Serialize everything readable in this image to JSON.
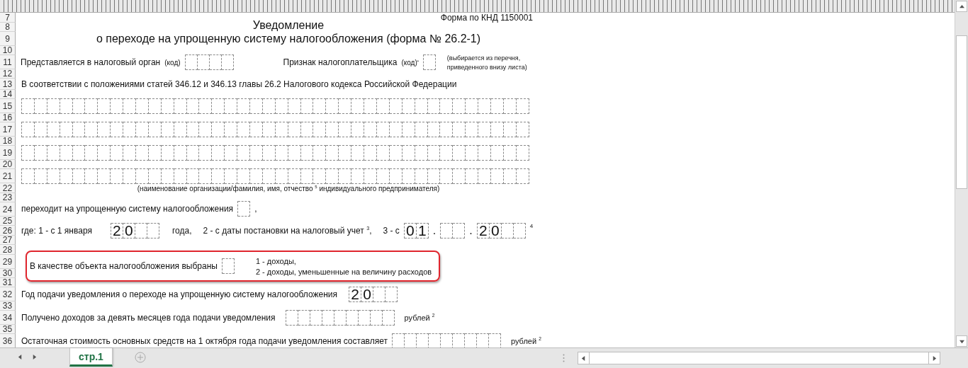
{
  "row_numbers": [
    "7",
    "8",
    "9",
    "10",
    "11",
    "12",
    "13",
    "14",
    "15",
    "16",
    "17",
    "18",
    "19",
    "20",
    "21",
    "22",
    "23",
    "24",
    "25",
    "26",
    "27",
    "28",
    "29",
    "30",
    "31",
    "32",
    "33",
    "34",
    "35",
    "36"
  ],
  "form_code": "Форма по КНД 1150001",
  "title": "Уведомление",
  "subtitle": "о переходе на упрощенную систему налогообложения (форма № 26.2-1)",
  "tax_authority": {
    "label": "Представляется в налоговый орган",
    "code_label": "(код)",
    "cells": [
      {},
      {},
      {},
      {}
    ]
  },
  "taxpayer_sign": {
    "label": "Признак налогоплательщика",
    "code_label": "(код)$^{•}$",
    "cells": [
      {}
    ],
    "note_lines": [
      "(выбирается из перечня,",
      "приведенного внизу листа)"
    ]
  },
  "legal_basis": "В соответствии с положениями статей 346.12 и 346.13 главы 26.2 Налогового кодекса Российской Федерации",
  "name_rows": [
    {
      "cells": [
        {},
        {},
        {},
        {},
        {},
        {},
        {},
        {},
        {},
        {},
        {},
        {},
        {},
        {},
        {},
        {},
        {},
        {},
        {},
        {},
        {},
        {},
        {},
        {},
        {},
        {},
        {},
        {},
        {},
        {},
        {},
        {},
        {},
        {},
        {},
        {},
        {},
        {},
        {},
        {}
      ]
    },
    {
      "cells": [
        {},
        {},
        {},
        {},
        {},
        {},
        {},
        {},
        {},
        {},
        {},
        {},
        {},
        {},
        {},
        {},
        {},
        {},
        {},
        {},
        {},
        {},
        {},
        {},
        {},
        {},
        {},
        {},
        {},
        {},
        {},
        {},
        {},
        {},
        {},
        {},
        {},
        {},
        {},
        {}
      ]
    },
    {
      "cells": [
        {},
        {},
        {},
        {},
        {},
        {},
        {},
        {},
        {},
        {},
        {},
        {},
        {},
        {},
        {},
        {},
        {},
        {},
        {},
        {},
        {},
        {},
        {},
        {},
        {},
        {},
        {},
        {},
        {},
        {},
        {},
        {},
        {},
        {},
        {},
        {},
        {},
        {},
        {},
        {}
      ]
    },
    {
      "cells": [
        {},
        {},
        {},
        {},
        {},
        {},
        {},
        {},
        {},
        {},
        {},
        {},
        {},
        {},
        {},
        {},
        {},
        {},
        {},
        {},
        {},
        {},
        {},
        {},
        {},
        {},
        {},
        {},
        {},
        {},
        {},
        {},
        {},
        {},
        {},
        {},
        {},
        {},
        {},
        {}
      ]
    }
  ],
  "name_caption": "(наименование организации/фамилия, имя, отчество $^{5}$  индивидуального предпринимателя)",
  "transition": {
    "label": "переходит на упрощенную систему налогообложения",
    "cells": [
      {}
    ],
    "suffix": ","
  },
  "start_date": {
    "label": "где: 1 - с 1 января",
    "year_cells": [
      {
        "value": "2"
      },
      {
        "value": "0"
      },
      {},
      {}
    ],
    "year_suffix": "года,",
    "option_2": "2 - с даты постановки на налоговый учет $^{3}$,",
    "option_3": "3 - с",
    "day_cells": [
      {
        "value": "0"
      },
      {
        "value": "1"
      }
    ],
    "separator_1": ".",
    "month_cells": [
      {},
      {}
    ],
    "separator_2": ".",
    "date_year_cells": [
      {
        "value": "2"
      },
      {
        "value": "0"
      },
      {},
      {}
    ],
    "footnote": "4"
  },
  "tax_object": {
    "highlighted": true,
    "label": "В качестве объекта налогообложения выбраны",
    "cells": [
      {}
    ],
    "options": [
      "1 - доходы,",
      "2 - доходы, уменьшенные на величину расходов"
    ]
  },
  "notice_year": {
    "label": "Год подачи уведомления о переходе на упрощенную систему налогообложения",
    "cells": [
      {
        "value": "2"
      },
      {
        "value": "0"
      },
      {},
      {}
    ]
  },
  "income": {
    "label": "Получено доходов за девять месяцев года подачи уведомления",
    "cells": [
      {},
      {},
      {},
      {},
      {},
      {},
      {},
      {},
      {}
    ],
    "unit": "рублей $^{2}$"
  },
  "residual_value": {
    "label": "Остаточная стоимость основных средств на 1 октября года подачи уведомления составляет",
    "cells": [
      {},
      {},
      {},
      {},
      {},
      {},
      {},
      {},
      {}
    ],
    "unit": "рублей $^{2}$"
  },
  "sheet_tabs": [
    {
      "label": "стр.1",
      "selected": true
    }
  ]
}
